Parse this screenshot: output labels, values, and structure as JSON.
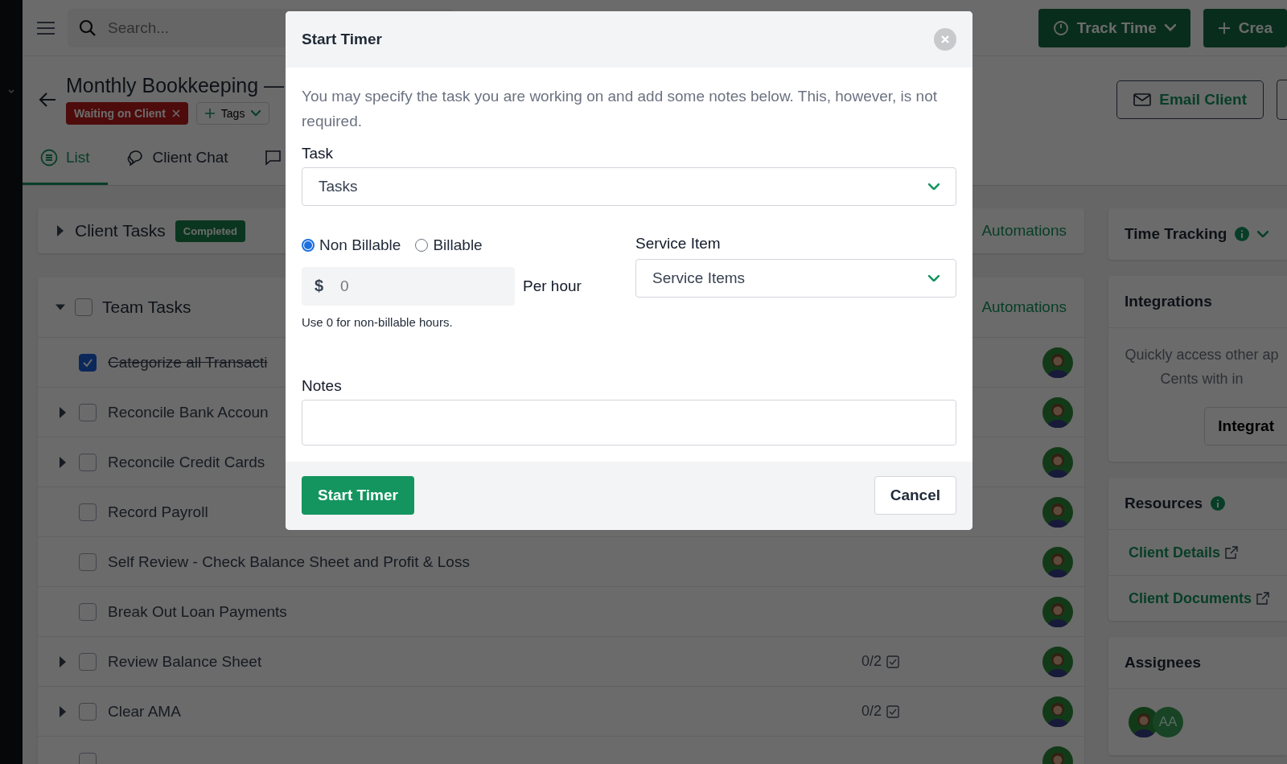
{
  "topbar": {
    "search_placeholder": "Search...",
    "buttons": [
      {
        "kind": "track",
        "label": "Track Time"
      },
      {
        "kind": "create",
        "label": "Crea"
      }
    ]
  },
  "header": {
    "title": "Monthly Bookkeeping —",
    "tags": [
      {
        "label": "Waiting on Client"
      }
    ],
    "tags_button": "Tags",
    "actions": [
      "Email Client"
    ]
  },
  "tabs": [
    {
      "kind": "list",
      "label": "List",
      "selected": true
    },
    {
      "kind": "chat",
      "label": "Client Chat",
      "selected": false
    },
    {
      "kind": "comment",
      "selected": false
    }
  ],
  "sections": [
    {
      "title": "Client Tasks",
      "badge": "Completed",
      "expanded": false,
      "link": "Automations"
    },
    {
      "title": "Team Tasks",
      "expanded": true,
      "checked": false,
      "link": "Automations",
      "rows": [
        {
          "text": "Categorize all Transacti",
          "checked": true,
          "has_children": false
        },
        {
          "text": "Reconcile Bank Accoun",
          "checked": false,
          "has_children": true
        },
        {
          "text": "Reconcile Credit Cards",
          "checked": false,
          "has_children": true
        },
        {
          "text": "Record Payroll",
          "checked": false,
          "has_children": false
        },
        {
          "text": "Self Review - Check Balance Sheet and Profit & Loss",
          "checked": false,
          "has_children": false
        },
        {
          "text": "Break Out Loan Payments",
          "checked": false,
          "has_children": false
        },
        {
          "text": "Review Balance Sheet",
          "checked": false,
          "has_children": true,
          "count": "0/2"
        },
        {
          "text": "Clear AMA",
          "checked": false,
          "has_children": true,
          "count": "0/2"
        },
        {
          "checked": false,
          "has_children": false
        }
      ]
    }
  ],
  "sidebar": {
    "time_tracking": {
      "title": "Time Tracking"
    },
    "integrations": {
      "title": "Integrations",
      "lines": [
        "Quickly access other ap",
        "Cents with in"
      ],
      "button": "Integrat"
    },
    "resources": {
      "title": "Resources",
      "links": [
        "Client Details",
        "Client Documents"
      ]
    },
    "assignees": {
      "title": "Assignees",
      "people": [
        {
          "kind": "photo"
        },
        {
          "kind": "initials",
          "initials": "AA"
        }
      ]
    }
  },
  "modal": {
    "title": "Start Timer",
    "description": "You may specify the task you are working on and add some notes below. This, however, is not required.",
    "task": {
      "label": "Task",
      "value": "Tasks"
    },
    "billing": [
      {
        "label": "Non Billable",
        "selected": true
      },
      {
        "label": "Billable",
        "selected": false
      }
    ],
    "rate": {
      "currency": "$",
      "placeholder": "0",
      "suffix": "Per hour",
      "hint": "Use 0 for non-billable hours."
    },
    "service_item": {
      "label": "Service Item",
      "value": "Service Items"
    },
    "notes": {
      "label": "Notes"
    },
    "buttons": {
      "primary": "Start Timer",
      "secondary": "Cancel"
    }
  }
}
